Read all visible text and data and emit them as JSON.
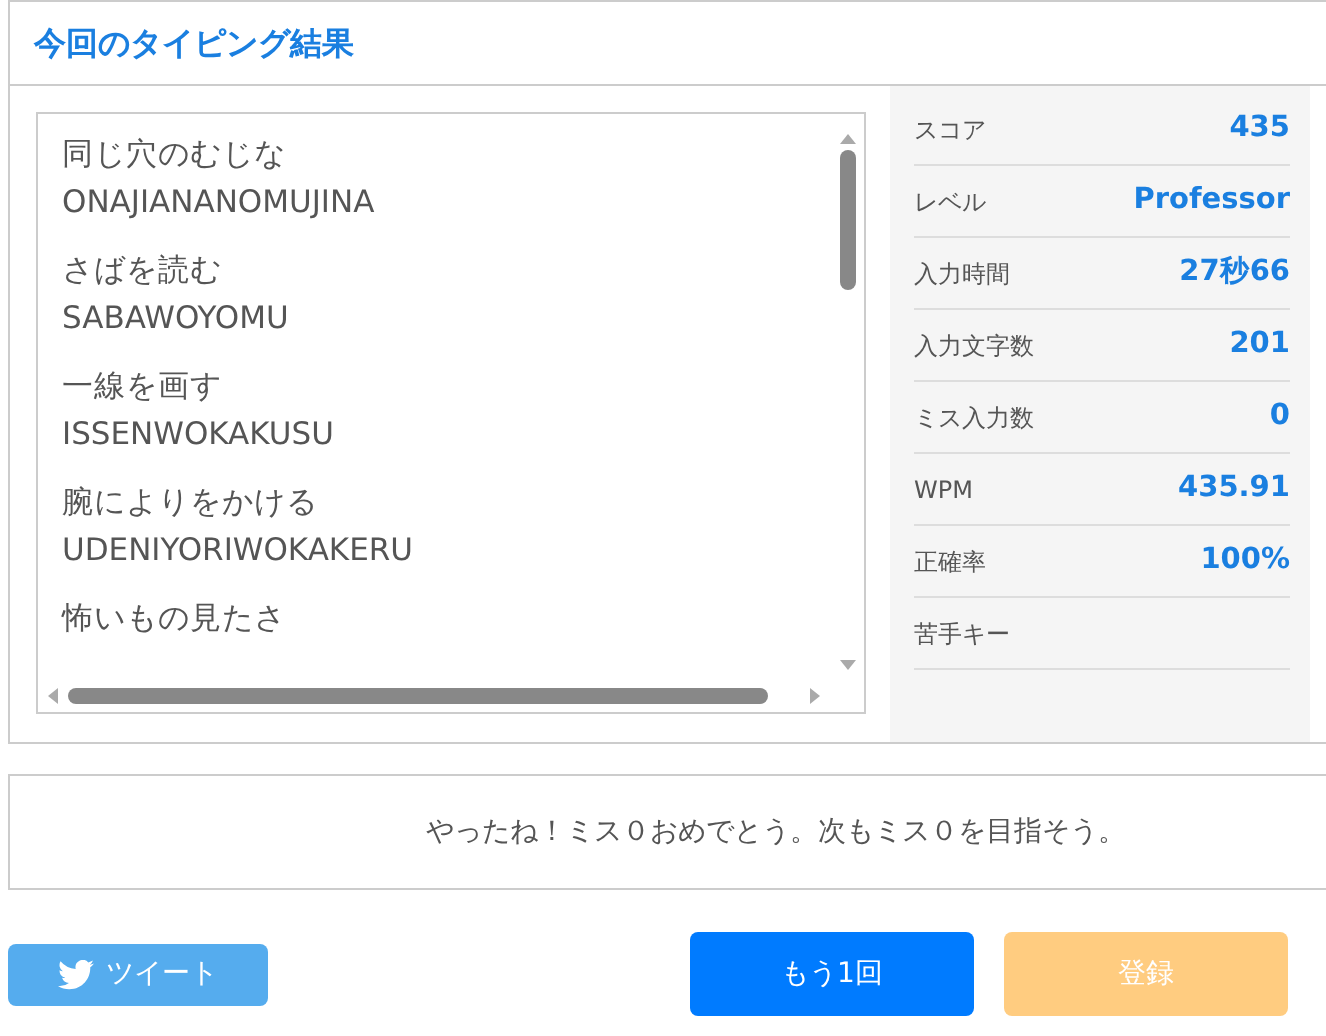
{
  "title": "今回のタイピング結果",
  "words": [
    {
      "kana": "同じ穴のむじな",
      "romaji": "ONAJIANANOMUJINA"
    },
    {
      "kana": "さばを読む",
      "romaji": "SABAWOYOMU"
    },
    {
      "kana": "一線を画す",
      "romaji": "ISSENWOKAKUSU"
    },
    {
      "kana": "腕によりをかける",
      "romaji": "UDENIYORIWOKAKERU"
    },
    {
      "kana": "怖いもの見たさ"
    }
  ],
  "stats": [
    {
      "label": "スコア",
      "value": "435"
    },
    {
      "label": "レベル",
      "value": "Professor"
    },
    {
      "label": "入力時間",
      "value": "27秒66"
    },
    {
      "label": "入力文字数",
      "value": "201"
    },
    {
      "label": "ミス入力数",
      "value": "0"
    },
    {
      "label": "WPM",
      "value": "435.91"
    },
    {
      "label": "正確率",
      "value": "100%"
    },
    {
      "label": "苦手キー"
    }
  ],
  "message": "やったね！ミス０おめでとう。次もミス０を目指そう。",
  "buttons": [
    {
      "kind": "tweet",
      "label": "ツイート",
      "disabled": false
    },
    {
      "kind": "retry",
      "label": "もう1回",
      "disabled": false
    },
    {
      "kind": "register",
      "label": "登録",
      "disabled": true
    }
  ]
}
